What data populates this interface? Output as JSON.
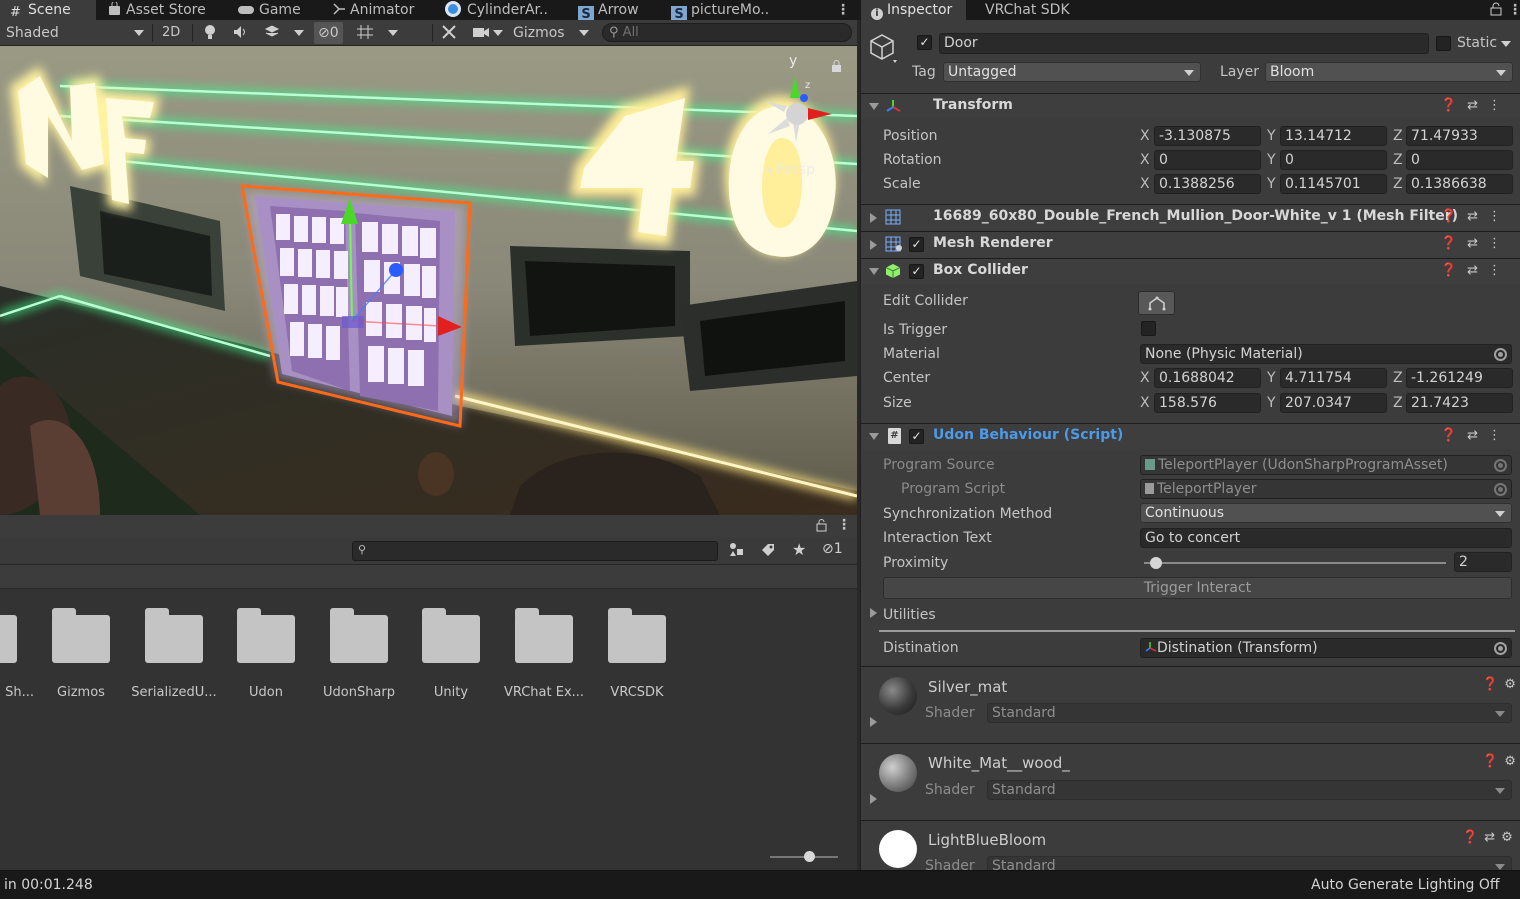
{
  "tabs": {
    "scene": "Scene",
    "asset_store": "Asset Store",
    "game": "Game",
    "animator": "Animator",
    "cylinder": "CylinderAr..",
    "arrow": "Arrow",
    "picture": "pictureMo..",
    "inspector": "Inspector",
    "vrchat_sdk": "VRChat SDK"
  },
  "scene_toolbar": {
    "shading_mode": "Shaded",
    "mode_2d": "2D",
    "hidden_count": "0",
    "gizmos": "Gizmos",
    "search_placeholder": "All"
  },
  "scene_view": {
    "projection_label": "Persp",
    "axis_y": "y",
    "axis_z": "z"
  },
  "project": {
    "hidden_count": "1",
    "folders": [
      {
        "name": "Sh..."
      },
      {
        "name": "Gizmos"
      },
      {
        "name": "SerializedU..."
      },
      {
        "name": "Udon"
      },
      {
        "name": "UdonSharp"
      },
      {
        "name": "Unity"
      },
      {
        "name": "VRChat Ex..."
      },
      {
        "name": "VRCSDK"
      }
    ]
  },
  "status": {
    "left": "in 00:01.248",
    "right": "Auto Generate Lighting Off"
  },
  "inspector": {
    "object_name": "Door",
    "static_label": "Static",
    "tag_label": "Tag",
    "tag_value": "Untagged",
    "layer_label": "Layer",
    "layer_value": "Bloom",
    "transform": {
      "title": "Transform",
      "position_label": "Position",
      "rotation_label": "Rotation",
      "scale_label": "Scale",
      "position": {
        "x": "-3.130875",
        "y": "13.14712",
        "z": "71.47933"
      },
      "rotation": {
        "x": "0",
        "y": "0",
        "z": "0"
      },
      "scale": {
        "x": "0.1388256",
        "y": "0.1145701",
        "z": "0.1386638"
      }
    },
    "mesh_filter": {
      "title": "16689_60x80_Double_French_Mullion_Door-White_v 1 (Mesh Filter)"
    },
    "mesh_renderer": {
      "title": "Mesh Renderer"
    },
    "box_collider": {
      "title": "Box Collider",
      "edit_collider_label": "Edit Collider",
      "is_trigger_label": "Is Trigger",
      "material_label": "Material",
      "material_value": "None (Physic Material)",
      "center_label": "Center",
      "size_label": "Size",
      "center": {
        "x": "0.1688042",
        "y": "4.711754",
        "z": "-1.261249"
      },
      "size": {
        "x": "158.576",
        "y": "207.0347",
        "z": "21.7423"
      }
    },
    "udon": {
      "title": "Udon Behaviour (Script)",
      "program_source_label": "Program Source",
      "program_source_value": "TeleportPlayer (UdonSharpProgramAsset)",
      "program_script_label": "Program Script",
      "program_script_value": "TeleportPlayer",
      "sync_label": "Synchronization Method",
      "sync_value": "Continuous",
      "interaction_label": "Interaction Text",
      "interaction_value": "Go to concert",
      "proximity_label": "Proximity",
      "proximity_value": "2",
      "proximity_fraction": 0.02,
      "trigger_button": "Trigger Interact",
      "utilities_label": "Utilities",
      "destination_label": "Distination",
      "destination_value": "Distination (Transform)"
    },
    "axis_labels": {
      "x": "X",
      "y": "Y",
      "z": "Z"
    },
    "materials": [
      {
        "name": "Silver_mat",
        "shader_label": "Shader",
        "shader": "Standard"
      },
      {
        "name": "White_Mat__wood_",
        "shader_label": "Shader",
        "shader": "Standard"
      },
      {
        "name": "LightBlueBloom",
        "shader_label": "Shader",
        "shader": "Standard"
      }
    ]
  }
}
